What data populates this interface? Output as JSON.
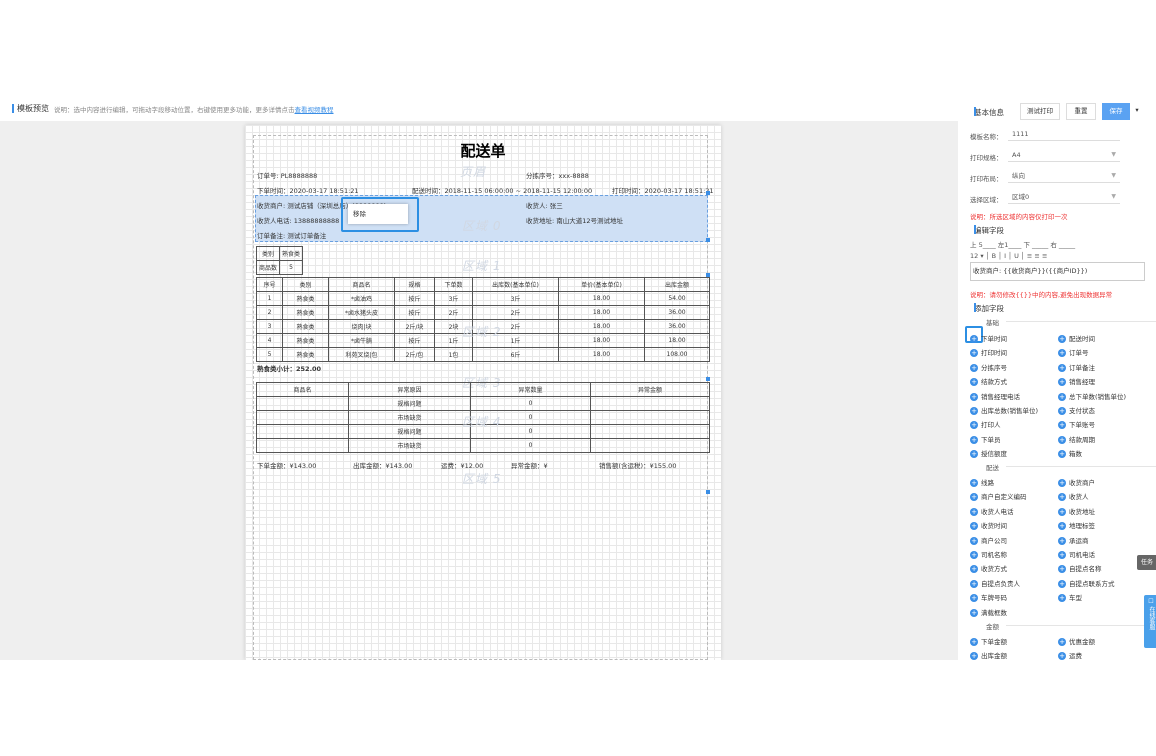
{
  "header": {
    "title": "模板预览",
    "desc": "说明：选中内容进行编辑，可拖动字段移动位置，右键使用更多功能，更多详情点击",
    "link": "查看视频教程"
  },
  "paper": {
    "title": "配送单",
    "watermarks": [
      "页眉",
      "区域 0",
      "区域 1",
      "区域 2",
      "区域 3",
      "区域 4",
      "区域 5"
    ],
    "order_no": "订单号: PL8888888",
    "sort_no": "分拣序号：xxx-8888",
    "order_time": "下单时间：2020-03-17 18:51:21",
    "delivery_time": "配送时间：2018-11-15 06:00:00 ~ 2018-11-15 12:00:00",
    "print_time": "打印时间：2020-03-17 18:51:21",
    "receiver_shop": "收货商户: 测试店铺（深圳总店）(S888888)",
    "receiver": "收货人: 张三",
    "receiver_phone": "收货人电话: 13888888888",
    "receiver_addr": "收货地址: 南山大道12号测试地址",
    "remark": "订单备注: 测试订单备注",
    "context_menu": "移除",
    "summary": {
      "headers": [
        "类别",
        "熟食类"
      ],
      "rows": [
        [
          "商品数",
          "5"
        ]
      ]
    },
    "items": {
      "headers": [
        "序号",
        "类别",
        "商品名",
        "规格",
        "下单数",
        "出库数(基本单位)",
        "单价(基本单位)",
        "出库金额"
      ],
      "rows": [
        [
          "1",
          "熟食类",
          "*卤油鸡",
          "按斤",
          "3斤",
          "3斤",
          "18.00",
          "54.00"
        ],
        [
          "2",
          "熟食类",
          "*卤水猪头皮",
          "按斤",
          "2斤",
          "2斤",
          "18.00",
          "36.00"
        ],
        [
          "3",
          "熟食类",
          "烧肉|块",
          "2斤/块",
          "2块",
          "2斤",
          "18.00",
          "36.00"
        ],
        [
          "4",
          "熟食类",
          "*卤牛腩",
          "按斤",
          "1斤",
          "1斤",
          "18.00",
          "18.00"
        ],
        [
          "5",
          "熟食类",
          "利苑叉烧|包",
          "2斤/包",
          "1包",
          "6斤",
          "18.00",
          "108.00"
        ]
      ]
    },
    "subtotal": "熟食类小计：252.00",
    "abnormal": {
      "headers": [
        "商品名",
        "异常原因",
        "异常数量",
        "异常金额"
      ],
      "rows": [
        [
          "",
          "规格问题",
          "0",
          ""
        ],
        [
          "",
          "市场缺货",
          "0",
          ""
        ],
        [
          "",
          "规格问题",
          "0",
          ""
        ],
        [
          "",
          "市场缺货",
          "0",
          ""
        ]
      ]
    },
    "totals": [
      "下单金额：¥143.00",
      "出库金额：¥143.00",
      "运费：¥12.00",
      "异常金额：¥",
      "销售额(含运税)：¥155.00"
    ]
  },
  "right": {
    "basic_info": "基本信息",
    "test_print": "测试打印",
    "reset": "重置",
    "save": "保存",
    "more": "▾",
    "template_name_label": "模板名称：",
    "template_name": "1111",
    "print_spec_label": "打印规格：",
    "print_spec": "A4",
    "print_layout_label": "打印布局：",
    "print_layout": "纵向",
    "select_area_label": "选择区域：",
    "select_area": "区域0",
    "note1": "说明：所选区域的内容仅打印一次",
    "edit_field": "编辑字段",
    "margins": "上 5____ 左1____ 下 _____ 右 _____",
    "toolbar": "12 ▾ │ B │ I │ U │ ≡ ≡ ≡",
    "field_text": "收货商户: {{收货商户}}({{商户ID}})",
    "note2": "说明：请勿修改{{}}中的内容,避免出现数据异常",
    "add_field": "添加字段",
    "groups": {
      "basic": "基础",
      "delivery": "配送",
      "amount": "金额"
    },
    "basic_fields": [
      "下单时间",
      "配送时间",
      "打印时间",
      "订单号",
      "分拣序号",
      "订单备注",
      "结款方式",
      "销售经理",
      "销售经理电话",
      "总下单数(销售单位)",
      "出库总数(销售单位)",
      "支付状态",
      "打印人",
      "下单账号",
      "下单员",
      "结款周期",
      "授信额度",
      "箱数"
    ],
    "delivery_fields": [
      "线路",
      "收货商户",
      "商户自定义编码",
      "收货人",
      "收货人电话",
      "收货地址",
      "收货时间",
      "地理标签",
      "商户公司",
      "承运商",
      "司机名称",
      "司机电话",
      "收货方式",
      "自提点名称",
      "自提点负责人",
      "自提点联系方式",
      "车牌号码",
      "车型",
      "满载框数"
    ],
    "amount_fields": [
      "下单金额",
      "优惠金额",
      "出库金额",
      "运费"
    ],
    "task": "任务",
    "service": "在线客服"
  }
}
